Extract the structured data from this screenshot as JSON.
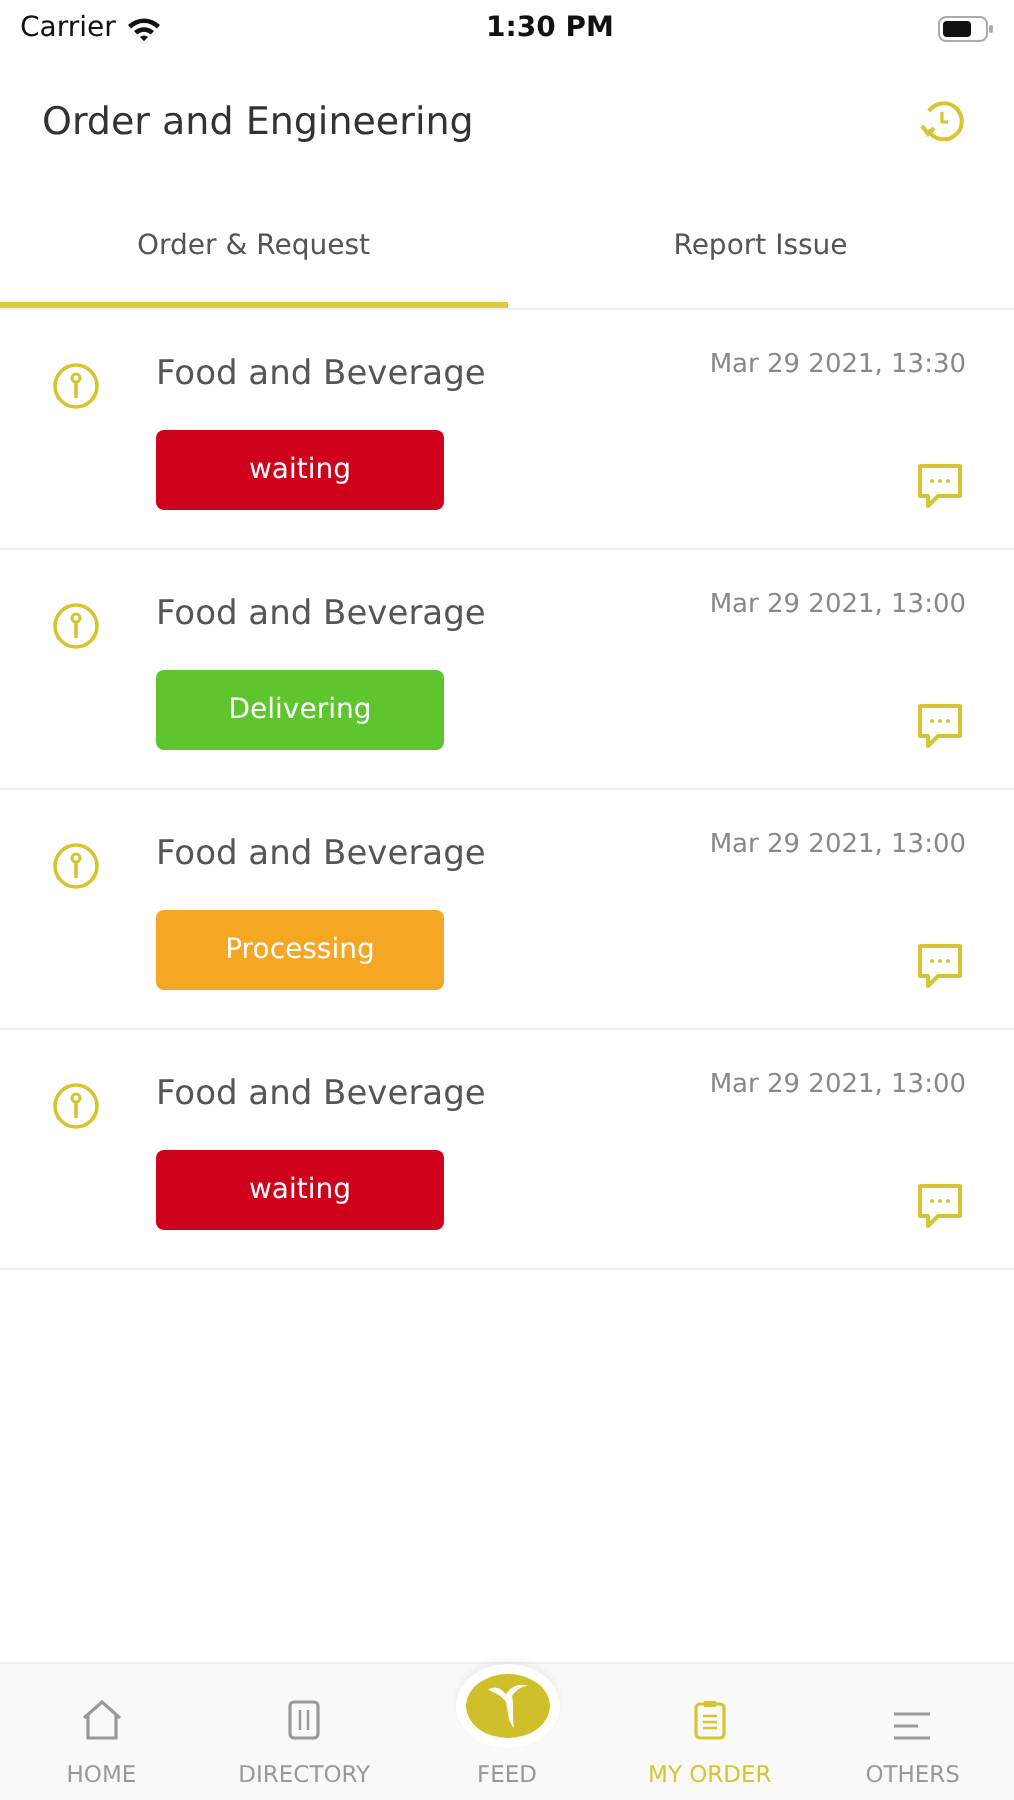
{
  "status_bar": {
    "carrier": "Carrier",
    "time": "1:30 PM"
  },
  "header": {
    "title": "Order and Engineering"
  },
  "tabs": [
    {
      "label": "Order & Request",
      "selected": true
    },
    {
      "label": "Report Issue",
      "selected": false
    }
  ],
  "orders": [
    {
      "title": "Food and Beverage",
      "time": "Mar 29 2021, 13:30",
      "status": "waiting",
      "color": "#d0021b"
    },
    {
      "title": "Food and Beverage",
      "time": "Mar 29 2021, 13:00",
      "status": "Delivering",
      "color": "#5fc52e"
    },
    {
      "title": "Food and Beverage",
      "time": "Mar 29 2021, 13:00",
      "status": "Processing",
      "color": "#f5a623"
    },
    {
      "title": "Food and Beverage",
      "time": "Mar 29 2021, 13:00",
      "status": "waiting",
      "color": "#d0021b"
    }
  ],
  "nav": [
    {
      "kind": "home",
      "label": "HOME",
      "selected": false
    },
    {
      "kind": "directory",
      "label": "DIRECTORY",
      "selected": false
    },
    {
      "kind": "feed",
      "label": "FEED",
      "selected": false
    },
    {
      "kind": "order",
      "label": "MY ORDER",
      "selected": true
    },
    {
      "kind": "others",
      "label": "OTHERS",
      "selected": false
    }
  ]
}
